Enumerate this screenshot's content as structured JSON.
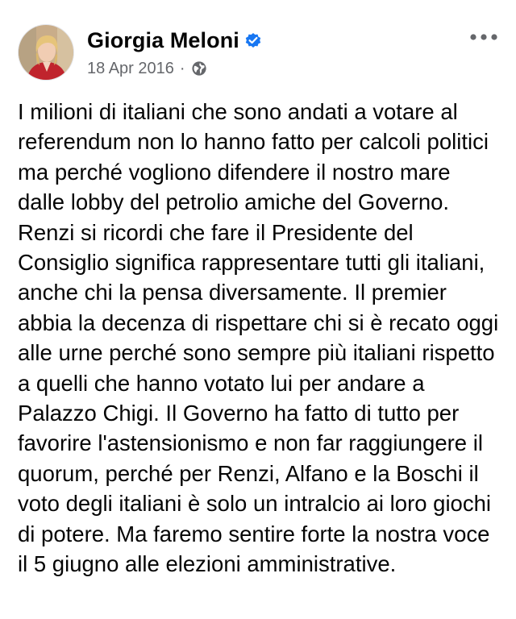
{
  "post": {
    "author": "Giorgia Meloni",
    "date": "18 Apr 2016",
    "separator": "·",
    "verified": true,
    "privacy_icon": "globe-icon",
    "more_icon": "more-options-icon",
    "body": "I milioni di italiani che sono andati a votare al referendum non lo hanno fatto per calcoli politici ma perché vogliono difendere il nostro mare dalle lobby del petrolio amiche del Governo. Renzi si ricordi che fare il Presidente del Consiglio significa rappresentare tutti gli italiani, anche chi la pensa diversamente. Il premier abbia la decenza di rispettare chi si è recato oggi alle urne perché sono sempre più italiani rispetto a quelli che hanno votato lui per andare a Palazzo Chigi. Il Governo ha fatto di tutto per favorire l'astensionismo e non far raggiungere il quorum, perché per Renzi, Alfano e la Boschi il voto degli italiani è solo un intralcio ai loro giochi di potere. Ma faremo sentire forte la nostra voce il 5 giugno alle elezioni amministrative."
  },
  "colors": {
    "verified_badge": "#1877f2",
    "meta_text": "#65676b",
    "body_text": "#050505"
  }
}
